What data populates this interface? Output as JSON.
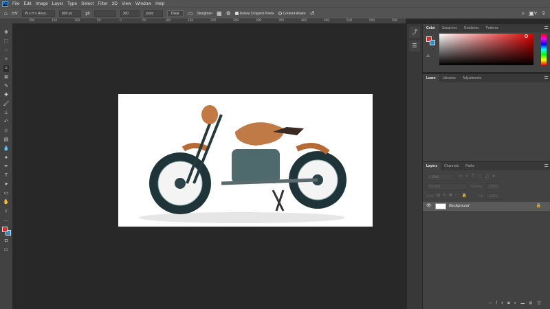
{
  "menu": [
    "File",
    "Edit",
    "Image",
    "Layer",
    "Type",
    "Select",
    "Filter",
    "3D",
    "View",
    "Window",
    "Help"
  ],
  "options": {
    "ratio": "W x H x Reso...",
    "width": "800 px",
    "height": "",
    "resolution": "300",
    "units": "px/in",
    "clear": "Clear",
    "straighten": "Straighten",
    "delete_cropped": "Delete Cropped Pixels",
    "content_aware": "Content-Aware",
    "delete_cropped_checked": true,
    "content_aware_checked": false
  },
  "ruler": [
    "200",
    "150",
    "100",
    "50",
    "0",
    "50",
    "100",
    "150",
    "200",
    "250",
    "300",
    "350",
    "400",
    "450",
    "500",
    "550",
    "600"
  ],
  "color_panel": {
    "tabs": [
      "Color",
      "Swatches",
      "Gradients",
      "Patterns"
    ],
    "foreground": "#e8242a",
    "background": "#2a8fd0"
  },
  "learn_panel": {
    "tabs": [
      "Learn",
      "Libraries",
      "Adjustments"
    ]
  },
  "layers_panel": {
    "tabs": [
      "Layers",
      "Channels",
      "Paths"
    ],
    "filter_placeholder": "Kind",
    "blend_mode": "Normal",
    "opacity_label": "Opacity:",
    "opacity": "100%",
    "lock_label": "Lock:",
    "fill_label": "Fill:",
    "fill": "100%",
    "layers": [
      {
        "name": "Background",
        "visible": true,
        "locked": true
      }
    ]
  }
}
